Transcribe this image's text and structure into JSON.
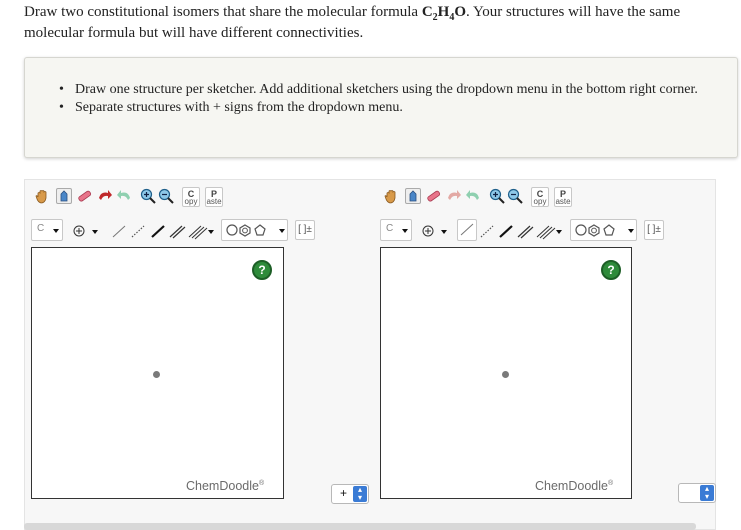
{
  "question": {
    "prefix": "Draw two constitutional isomers that share the molecular formula ",
    "formula_c": "C",
    "formula_c_sub": "2",
    "formula_h": "H",
    "formula_h_sub": "4",
    "formula_o": "O",
    "suffix": ". Your structures will have the same molecular formula but will have different connectivities."
  },
  "instructions": {
    "items": [
      "Draw one structure per sketcher. Add additional sketchers using the dropdown menu in the bottom right corner.",
      "Separate structures with + signs from the dropdown menu."
    ]
  },
  "sketchers": [
    {
      "copy_label": "C",
      "copy_sub": "opy",
      "paste_label": "P",
      "paste_sub": "aste",
      "element_value": "C",
      "brand": "ChemDoodle",
      "brand_mark": "®",
      "help_label": "?"
    },
    {
      "copy_label": "C",
      "copy_sub": "opy",
      "paste_label": "P",
      "paste_sub": "aste",
      "element_value": "C",
      "brand": "ChemDoodle",
      "brand_mark": "®",
      "help_label": "?"
    }
  ],
  "separator_select": {
    "value": "+"
  },
  "add_sketcher_select": {
    "value": ""
  },
  "icons": {
    "hand": "hand-icon",
    "eraser": "eraser-icon",
    "lasso": "lasso-icon",
    "undo": "undo-icon",
    "redo": "redo-icon",
    "zoom_in": "zoom-in-icon",
    "zoom_out": "zoom-out-icon",
    "charge": "charge-icon",
    "bond": "bond-icon",
    "ring": "ring-icon",
    "bracket": "bracket-icon"
  },
  "colors": {
    "help": "#2e8b3a",
    "select_arrow": "#3a7bd5",
    "brand_text": "#6b6b6b"
  }
}
